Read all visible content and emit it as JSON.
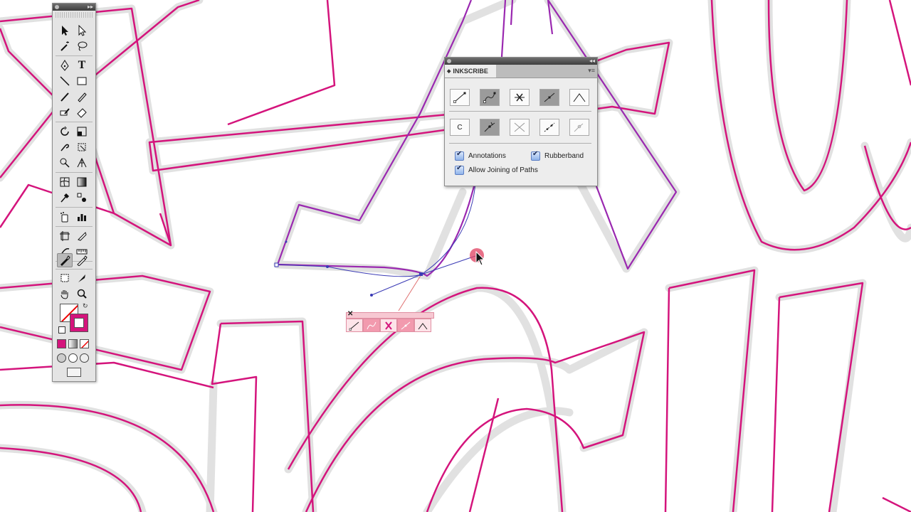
{
  "panel": {
    "title": "INKSCRIBE",
    "options": {
      "annotations": "Annotations",
      "rubberband": "Rubberband",
      "allow_joining": "Allow Joining of Paths"
    },
    "c_button": "C"
  },
  "tools_panel": {
    "text_tool_glyph": "T"
  },
  "icons": {
    "inkscribe_row1": [
      "segment-icon",
      "curve-segment-icon",
      "delete-anchor-icon",
      "line-segment-icon",
      "corner-icon"
    ],
    "inkscribe_row2": [
      "close-path-c-icon",
      "smooth-anchor-icon",
      "cross-icon",
      "dotted-line-icon",
      "disabled-anchor-icon"
    ],
    "popup": [
      "line-icon",
      "curve-icon",
      "delete-x-icon",
      "smooth-icon",
      "corner-icon"
    ]
  },
  "colors": {
    "stroke": "#d4147c",
    "stroke_purple": "#9a28b0",
    "halo": "#dadada",
    "path_blue": "#3a3ab5",
    "popup_bg": "#fde4e9"
  }
}
